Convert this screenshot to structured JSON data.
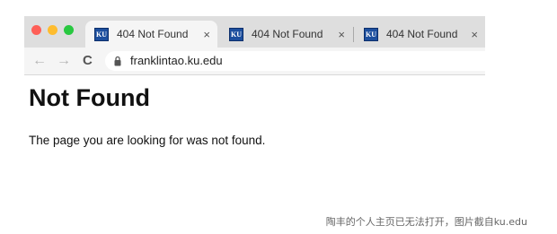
{
  "browser": {
    "tabs": [
      {
        "favicon_text": "KU",
        "title": "404 Not Found",
        "close": "×",
        "active": true
      },
      {
        "favicon_text": "KU",
        "title": "404 Not Found",
        "close": "×",
        "active": false
      },
      {
        "favicon_text": "KU",
        "title": "404 Not Found",
        "close": "×",
        "active": false
      }
    ],
    "nav": {
      "back": "←",
      "forward": "→",
      "reload": "C"
    },
    "url": "franklintao.ku.edu"
  },
  "page": {
    "heading": "Not Found",
    "message": "The page you are looking for was not found."
  },
  "caption": "陶丰的个人主页已无法打开，图片截自ku.edu",
  "colors": {
    "favicon_bg": "#1d4f9e",
    "traffic_red": "#fe5f57",
    "traffic_yellow": "#febc2e",
    "traffic_green": "#28c840"
  }
}
